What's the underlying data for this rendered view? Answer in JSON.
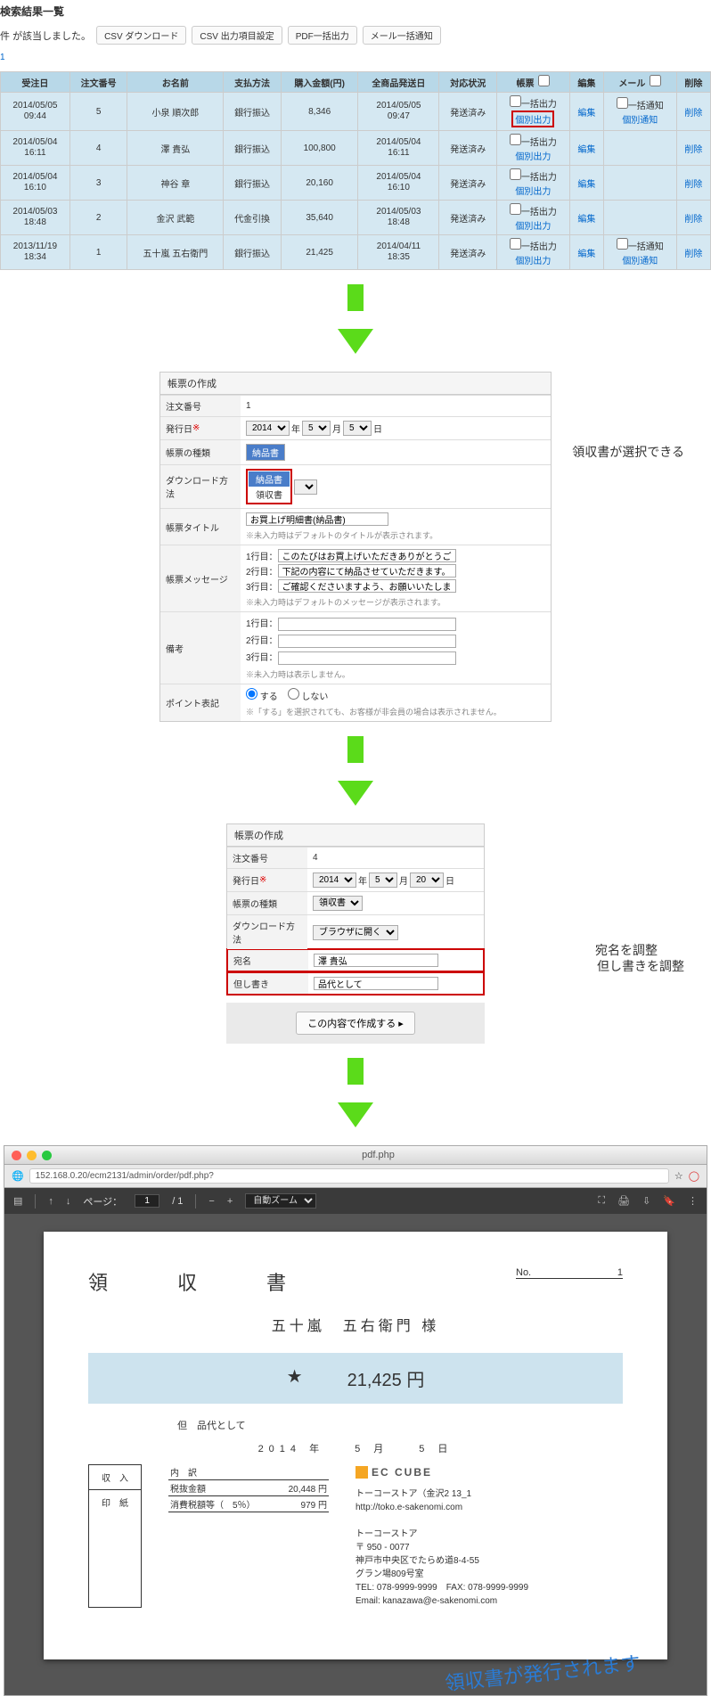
{
  "listing": {
    "title": "検索結果一覧",
    "count_prefix": "件",
    "count_suffix": "が該当しました。",
    "buttons": {
      "csv_dl": "CSV ダウンロード",
      "csv_cfg": "CSV 出力項目設定",
      "pdf": "PDF一括出力",
      "mail": "メール一括通知"
    },
    "headers": [
      "受注日",
      "注文番号",
      "お名前",
      "支払方法",
      "購入金額(円)",
      "全商品発送日",
      "対応状況",
      "帳票",
      "編集",
      "メール",
      "削除"
    ],
    "ikkatsu": "一括出力",
    "kobetsu": "個別出力",
    "ikkatsu_notice": "一括通知",
    "kobetsu_notice": "個別通知",
    "edit": "編集",
    "delete": "削除",
    "status": "発送済み",
    "rows": [
      {
        "dt1": "2014/05/05",
        "dt2": "09:44",
        "no": "5",
        "name": "小泉 順次郎",
        "pay": "銀行振込",
        "amt": "8,346",
        "sh1": "2014/05/05",
        "sh2": "09:47",
        "has_mail": true,
        "kobetsu_red": true
      },
      {
        "dt1": "2014/05/04",
        "dt2": "16:11",
        "no": "4",
        "name": "澤 貴弘",
        "pay": "銀行振込",
        "amt": "100,800",
        "sh1": "2014/05/04",
        "sh2": "16:11"
      },
      {
        "dt1": "2014/05/04",
        "dt2": "16:10",
        "no": "3",
        "name": "神谷 章",
        "pay": "銀行振込",
        "amt": "20,160",
        "sh1": "2014/05/04",
        "sh2": "16:10"
      },
      {
        "dt1": "2014/05/03",
        "dt2": "18:48",
        "no": "2",
        "name": "金沢 武範",
        "pay": "代金引換",
        "amt": "35,640",
        "sh1": "2014/05/03",
        "sh2": "18:48"
      },
      {
        "dt1": "2013/11/19",
        "dt2": "18:34",
        "no": "1",
        "name": "五十嵐 五右衛門",
        "pay": "銀行振込",
        "amt": "21,425",
        "sh1": "2014/04/11",
        "sh2": "18:35",
        "has_mail": true
      }
    ]
  },
  "form1": {
    "title": "帳票の作成",
    "order_no_lbl": "注文番号",
    "order_no": "1",
    "issue_lbl": "発行日",
    "year": "2014",
    "y_sfx": "年",
    "month": "5",
    "m_sfx": "月",
    "day": "5",
    "d_sfx": "日",
    "type_lbl": "帳票の種類",
    "type_sel": "納品書",
    "dl_lbl": "ダウンロード方法",
    "opts": [
      "納品書",
      "領収書"
    ],
    "title_lbl": "帳票タイトル",
    "title_val": "お買上げ明細書(納品書)",
    "title_note": "※未入力時はデフォルトのタイトルが表示されます。",
    "msg_lbl": "帳票メッセージ",
    "msg1_l": "1行目：",
    "msg1": "このたびはお買上げいただきありがとうご",
    "msg2_l": "2行目：",
    "msg2": "下記の内容にて納品させていただきます。",
    "msg3_l": "3行目：",
    "msg3": "ご確認くださいますよう、お願いいたしま",
    "msg_note": "※未入力時はデフォルトのメッセージが表示されます。",
    "remark_lbl": "備考",
    "r1": "1行目：",
    "r2": "2行目：",
    "r3": "3行目：",
    "remark_note": "※未入力時は表示しません。",
    "point_lbl": "ポイント表記",
    "point_yes": "する",
    "point_no": "しない",
    "point_note": "※「する」を選択されても、お客様が非会員の場合は表示されません。",
    "annotation": "領収書が選択できる"
  },
  "form2": {
    "title": "帳票の作成",
    "order_no_lbl": "注文番号",
    "order_no": "4",
    "issue_lbl": "発行日",
    "year": "2014",
    "y_sfx": "年",
    "month": "5",
    "m_sfx": "月",
    "day": "20",
    "d_sfx": "日",
    "type_lbl": "帳票の種類",
    "type_sel": "領収書",
    "dl_lbl": "ダウンロード方法",
    "dl_sel": "ブラウザに開く",
    "atena_lbl": "宛名",
    "atena": "澤 貴弘",
    "tadashi_lbl": "但し書き",
    "tadashi": "品代として",
    "submit": "この内容で作成する",
    "anno1": "宛名を調整",
    "anno2": "但し書きを調整"
  },
  "browser": {
    "tab": "pdf.php",
    "url": "152.168.0.20/ecm2131/admin/order/pdf.php?"
  },
  "pdf_toolbar": {
    "page_lbl": "ページ：",
    "page": "1",
    "total": "/ 1",
    "zoom": "自動ズーム"
  },
  "receipt": {
    "title": "領　収　書",
    "no_lbl": "No.",
    "no": "1",
    "recipient": "五十嵐　五右衛門 様",
    "star": "★",
    "amount": "21,425 円",
    "tadashi_l": "但",
    "tadashi": "品代として",
    "date": "2014 年　　5 月　　5 日",
    "stamp1": "収　入",
    "stamp2": "印　紙",
    "bd_h": "内　訳",
    "bd1_l": "税抜金額",
    "bd1_v": "20,448 円",
    "bd2_l": "消費税額等（　5％）",
    "bd2_v": "979 円",
    "logo": "EC CUBE",
    "c1": "トーコーストア（金沢2 13_1",
    "c2": "http://toko.e-sakenomi.com",
    "c3": "トーコーストア",
    "c4": "〒 950 - 0077",
    "c5": "神戸市中央区でたらめ道8-4-55",
    "c6": "グラン場809号室",
    "c7": "TEL: 078-9999-9999　FAX: 078-9999-9999",
    "c8": "Email: kanazawa@e-sakenomi.com",
    "diag": "領収書が発行されます"
  }
}
